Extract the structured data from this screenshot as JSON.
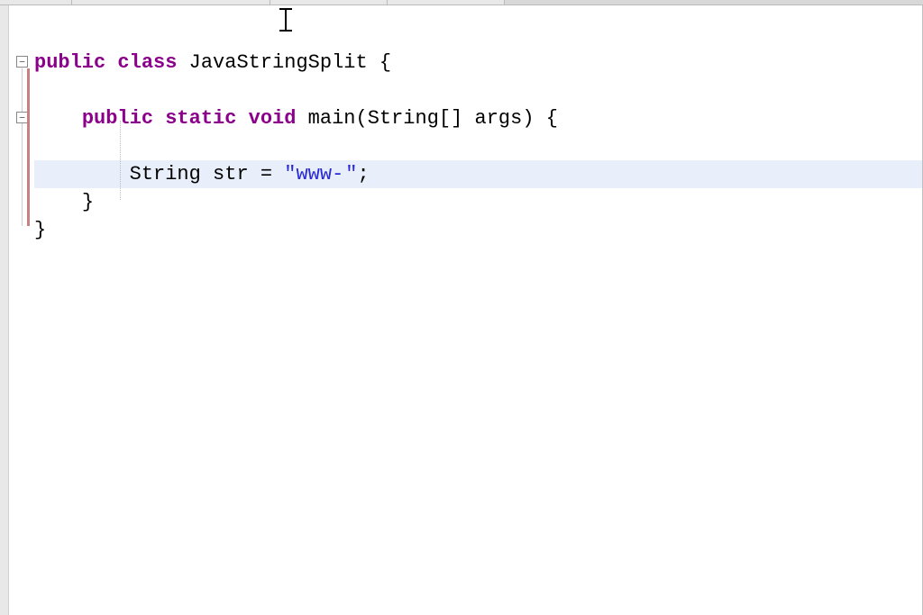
{
  "code": {
    "line1": {
      "public": "public",
      "class": "class",
      "classname": "JavaStringSplit",
      "brace": "{"
    },
    "line2": {
      "public": "public",
      "static": "static",
      "void": "void",
      "main": "main",
      "parenOpen": "(",
      "stringArr": "String[]",
      "args": "args",
      "parenClose": ")",
      "brace": "{"
    },
    "line3": {
      "type": "String",
      "var": "str",
      "equals": "=",
      "stringOpen": "\"",
      "stringVal": "www-",
      "stringClose": "\"",
      "semi": ";"
    },
    "line4": {
      "brace": "}"
    },
    "line5": {
      "brace": "}"
    }
  },
  "fold": {
    "collapsed": "−",
    "open": "−"
  }
}
